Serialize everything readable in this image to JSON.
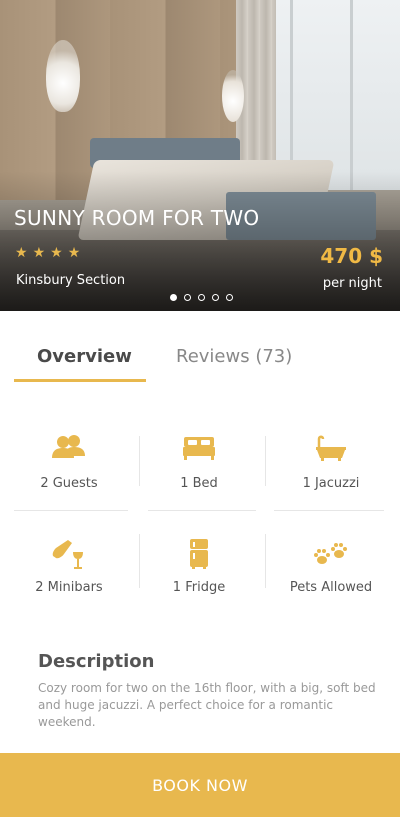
{
  "hero": {
    "title": "SUNNY ROOM FOR TWO",
    "rating_stars": 4,
    "section": "Kinsbury Section",
    "price": "470 $",
    "per_night": "per night",
    "carousel_total": 5,
    "carousel_active": 1
  },
  "tabs": [
    {
      "label": "Overview",
      "active": true
    },
    {
      "label": "Reviews (73)",
      "active": false
    }
  ],
  "amenities": [
    {
      "icon": "guests-icon",
      "label": "2 Guests"
    },
    {
      "icon": "bed-icon",
      "label": "1 Bed"
    },
    {
      "icon": "bathtub-icon",
      "label": "1 Jacuzzi"
    },
    {
      "icon": "minibar-icon",
      "label": "2 Minibars"
    },
    {
      "icon": "fridge-icon",
      "label": "1 Fridge"
    },
    {
      "icon": "paw-icon",
      "label": "Pets Allowed"
    }
  ],
  "description": {
    "title": "Description",
    "text": "Cozy room for two on the 16th floor, with a big, soft bed and huge jacuzzi. A perfect choice for a romantic weekend."
  },
  "book_button": "BOOK NOW",
  "colors": {
    "accent": "#e8b84e",
    "text": "#555555",
    "muted": "#999999"
  }
}
